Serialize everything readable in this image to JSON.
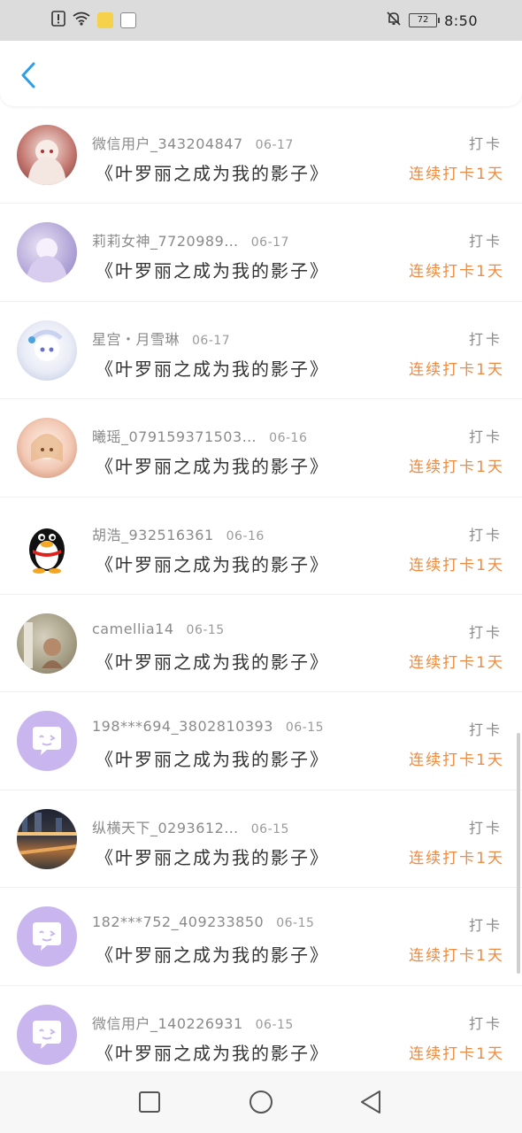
{
  "status_bar": {
    "time": "8:50",
    "battery_level": "72",
    "icons": [
      "alert-icon",
      "wifi-icon",
      "app-notification-icon",
      "app-notification-icon",
      "mute-bell-icon",
      "battery-icon"
    ]
  },
  "header": {
    "back_icon": "back-chevron-icon",
    "accent_color": "#2f9ee8"
  },
  "list": {
    "items": [
      {
        "user": "微信用户_343204847",
        "date": "06-17",
        "title": "《叶罗丽之成为我的影子》",
        "action": "打卡",
        "streak": "连续打卡1天"
      },
      {
        "user": "莉莉女神_7720989…",
        "date": "06-17",
        "title": "《叶罗丽之成为我的影子》",
        "action": "打卡",
        "streak": "连续打卡1天"
      },
      {
        "user": "星宫・月雪琳",
        "date": "06-17",
        "title": "《叶罗丽之成为我的影子》",
        "action": "打卡",
        "streak": "连续打卡1天"
      },
      {
        "user": "曦瑶_079159371503…",
        "date": "06-16",
        "title": "《叶罗丽之成为我的影子》",
        "action": "打卡",
        "streak": "连续打卡1天"
      },
      {
        "user": "胡浩_932516361",
        "date": "06-16",
        "title": "《叶罗丽之成为我的影子》",
        "action": "打卡",
        "streak": "连续打卡1天"
      },
      {
        "user": "camellia14",
        "date": "06-15",
        "title": "《叶罗丽之成为我的影子》",
        "action": "打卡",
        "streak": "连续打卡1天"
      },
      {
        "user": "198***694_3802810393",
        "date": "06-15",
        "title": "《叶罗丽之成为我的影子》",
        "action": "打卡",
        "streak": "连续打卡1天"
      },
      {
        "user": "纵横天下_0293612…",
        "date": "06-15",
        "title": "《叶罗丽之成为我的影子》",
        "action": "打卡",
        "streak": "连续打卡1天"
      },
      {
        "user": "182***752_409233850",
        "date": "06-15",
        "title": "《叶罗丽之成为我的影子》",
        "action": "打卡",
        "streak": "连续打卡1天"
      },
      {
        "user": "微信用户_140226931",
        "date": "06-15",
        "title": "《叶罗丽之成为我的影子》",
        "action": "打卡",
        "streak": "连续打卡1天"
      }
    ]
  },
  "colors": {
    "streak": "#f08a3e",
    "default_avatar": "#c9b6ee"
  },
  "nav_bar": {
    "icons": [
      "recent-apps-square-icon",
      "home-circle-icon",
      "back-triangle-icon"
    ]
  }
}
